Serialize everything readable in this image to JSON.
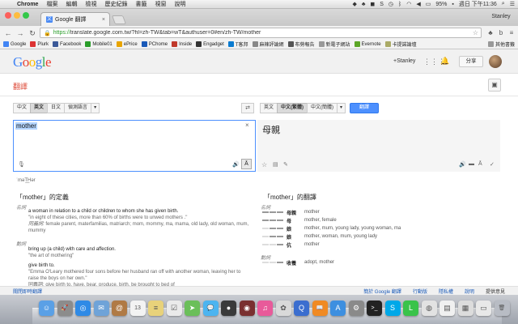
{
  "menubar": {
    "apple": "",
    "items": [
      "Chrome",
      "檔案",
      "編輯",
      "檢視",
      "歷史紀錄",
      "書籤",
      "視窗",
      "說明"
    ],
    "battery": "95%",
    "clock": "週日 下午11:36"
  },
  "browser": {
    "tab_title": "Google 翻譯",
    "tab_close": "×",
    "user_chip": "Stanley",
    "url_scheme": "https://",
    "url_rest": "translate.google.com.tw/?hl=zh-TW&tab=wT&authuser=0#en/zh-TW/mother",
    "bookmarks": [
      {
        "label": "Google",
        "color": "#4285f4"
      },
      {
        "label": "Plurk",
        "color": "#d33"
      },
      {
        "label": "Facebook",
        "color": "#3b5998"
      },
      {
        "label": "Mobile01",
        "color": "#2a9d2a"
      },
      {
        "label": "ePrice",
        "color": "#e8a400"
      },
      {
        "label": "PChome",
        "color": "#1a5ab8"
      },
      {
        "label": "Inside",
        "color": "#c0392b"
      },
      {
        "label": "Engadget",
        "color": "#333"
      },
      {
        "label": "T客邦",
        "color": "#0a7bd0"
      },
      {
        "label": "麻辣評論網",
        "color": "#888"
      },
      {
        "label": "布勞報告",
        "color": "#555"
      },
      {
        "label": "新電子網站",
        "color": "#999"
      },
      {
        "label": "Evernote",
        "color": "#5ba525"
      },
      {
        "label": "卡提諾論壇",
        "color": "#aa6"
      }
    ],
    "bookmarks_other": "其他書籤"
  },
  "google": {
    "logo": [
      "G",
      "o",
      "o",
      "g",
      "l",
      "e"
    ],
    "logo_colors": [
      "#4285f4",
      "#ea4335",
      "#fbbc05",
      "#4285f4",
      "#34a853",
      "#ea4335"
    ],
    "user_link": "+Stanley",
    "share": "分享"
  },
  "translate": {
    "title": "翻譯",
    "source_langs": [
      "中文",
      "英文",
      "日文",
      "偵測語言"
    ],
    "target_langs": [
      "英文",
      "中文(繁體)",
      "中文(簡體)"
    ],
    "translate_button": "翻譯",
    "source_text": "mother",
    "result_text": "母親",
    "phonetic": "ˈməT͟Hər"
  },
  "definitions": {
    "title_word": "mother",
    "title_prefix": "「",
    "title_suffix": "」的定義",
    "noun_label": "名詞",
    "noun_def": "a woman in relation to a child or children to whom she has given birth.",
    "noun_example": "\"in eight of these cities, more than 60% of births were to unwed mothers .\"",
    "noun_syn_label": "同義詞:",
    "noun_syn": "female parent, materfamilias, matriarch; mom, mommy, ma, mama, old lady, old woman, mum, mummy",
    "verb_label": "動詞",
    "verb_def": "bring up (a child) with care and affection.",
    "verb_example": "\"the art of mothering\"",
    "verb_def2": "give birth to.",
    "verb_example2": "\"Emma O'Leary mothered four sons before her husband ran off with another woman, leaving her to raise the boys on her own.\"",
    "verb_syn2": "同義詞: give birth to, have, bear, produce, birth, be brought to bed of"
  },
  "translations": {
    "title_word": "mother",
    "title_prefix": "「",
    "title_suffix": "」的翻譯",
    "noun_label": "名詞",
    "noun_rows": [
      {
        "word": "母親",
        "meaning": "mother",
        "level": 3
      },
      {
        "word": "母",
        "meaning": "mother, female",
        "level": 3
      },
      {
        "word": "娘",
        "meaning": "mother, mum, young lady, young woman, ma",
        "level": 2
      },
      {
        "word": "娘",
        "meaning": "mother, woman, mum, young lady",
        "level": 2
      },
      {
        "word": "伉",
        "meaning": "mother",
        "level": 1
      }
    ],
    "verb_label": "動詞",
    "verb_rows": [
      {
        "word": "收養",
        "meaning": "adopt, mother",
        "level": 1
      }
    ]
  },
  "footer": {
    "left": "關閉即時翻譯",
    "links": [
      "簡於 Google 翻譯",
      "行動版",
      "隱私權",
      "說明"
    ],
    "feedback": "提供意見"
  },
  "dock": [
    {
      "name": "finder",
      "color": "#5aa0e6",
      "glyph": "☺"
    },
    {
      "name": "launchpad",
      "color": "#8c8c8c",
      "glyph": "🚀"
    },
    {
      "name": "safari",
      "color": "#2f8ae6",
      "glyph": "◎"
    },
    {
      "name": "mail",
      "color": "#6fa3d8",
      "glyph": "✉"
    },
    {
      "name": "contacts",
      "color": "#b07a45",
      "glyph": "@"
    },
    {
      "name": "calendar",
      "color": "#f3f3f3",
      "glyph": "13"
    },
    {
      "name": "notes",
      "color": "#e8d27a",
      "glyph": "≡"
    },
    {
      "name": "reminders",
      "color": "#eaeaea",
      "glyph": "☑"
    },
    {
      "name": "maps",
      "color": "#6bbf5a",
      "glyph": "➤"
    },
    {
      "name": "messages",
      "color": "#4cb4f0",
      "glyph": "💬"
    },
    {
      "name": "facetime",
      "color": "#3a3a3a",
      "glyph": "●"
    },
    {
      "name": "photobooth",
      "color": "#7a3030",
      "glyph": "◉"
    },
    {
      "name": "itunes",
      "color": "#e85a9a",
      "glyph": "♫"
    },
    {
      "name": "photos",
      "color": "#d9d9d9",
      "glyph": "✿"
    },
    {
      "name": "quicktime",
      "color": "#3b6ecf",
      "glyph": "Q"
    },
    {
      "name": "ibooks",
      "color": "#f08a24",
      "glyph": "📖"
    },
    {
      "name": "appstore",
      "color": "#3d8fe0",
      "glyph": "A"
    },
    {
      "name": "preferences",
      "color": "#8a8a8a",
      "glyph": "⚙"
    },
    {
      "name": "terminal",
      "color": "#222",
      "glyph": ">_"
    },
    {
      "name": "skype",
      "color": "#00a8e8",
      "glyph": "S"
    },
    {
      "name": "line",
      "color": "#3ac34a",
      "glyph": "L"
    },
    {
      "name": "chrome",
      "color": "#e2e2e2",
      "glyph": "◍"
    },
    {
      "name": "documents",
      "color": "#f0f0f0",
      "glyph": "▤"
    },
    {
      "name": "downloads",
      "color": "#dcdcdc",
      "glyph": "▦"
    },
    {
      "name": "desktop",
      "color": "#e8e8e8",
      "glyph": "▭"
    },
    {
      "name": "trash",
      "color": "#b8bcc4",
      "glyph": "🗑"
    }
  ]
}
